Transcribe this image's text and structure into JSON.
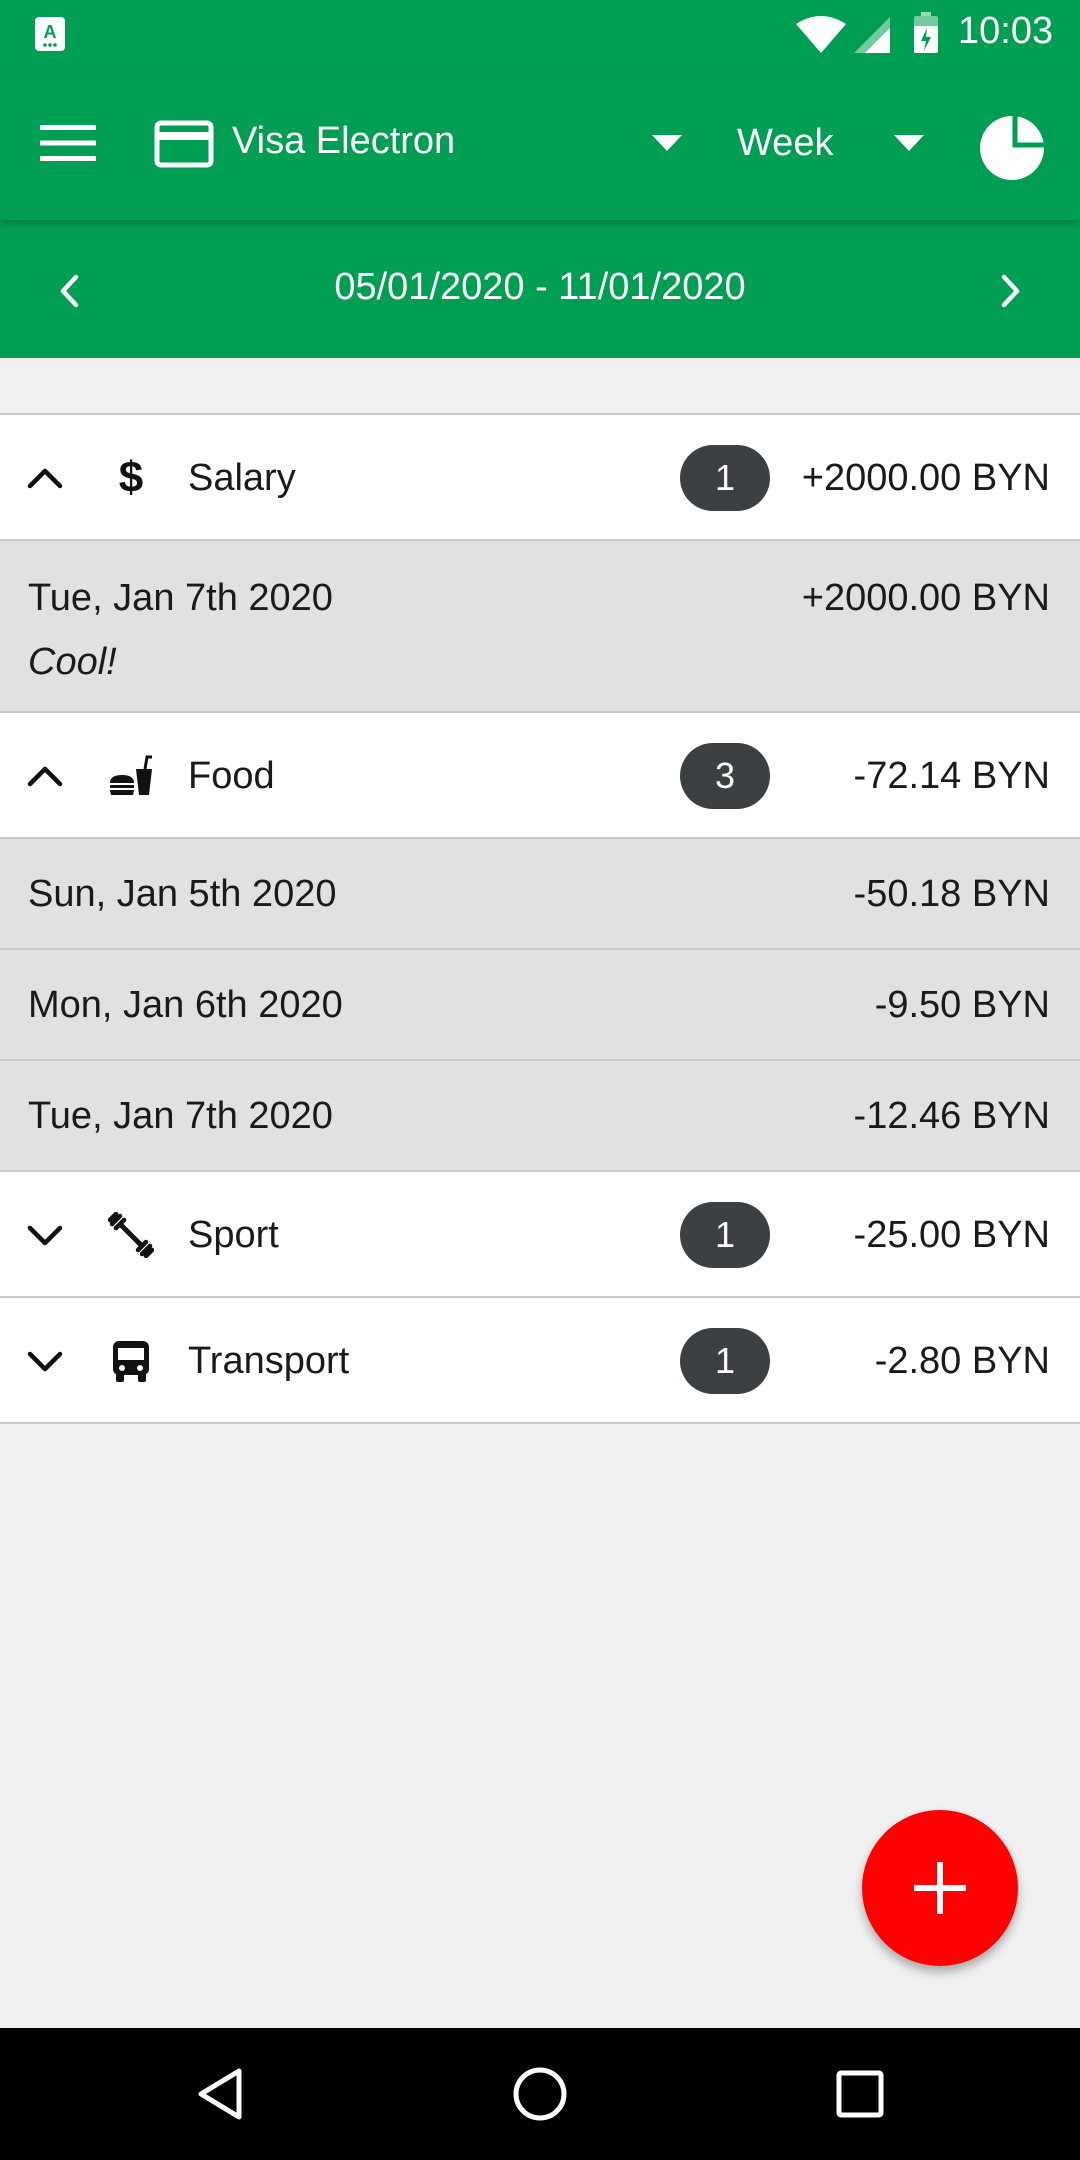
{
  "status_bar": {
    "time": "10:03",
    "icons": [
      "app-notification-icon",
      "wifi-icon",
      "signal-icon",
      "battery-charging-icon"
    ]
  },
  "toolbar": {
    "account_name": "Visa Electron",
    "period": "Week",
    "icons": [
      "menu-icon",
      "credit-card-icon",
      "dropdown-arrow-icon",
      "pie-chart-icon"
    ]
  },
  "range": {
    "label": "05/01/2020 - 11/01/2020"
  },
  "categories": [
    {
      "name": "Salary",
      "icon": "dollar-icon",
      "count": "1",
      "amount": "+2000.00 BYN",
      "expanded": true,
      "transactions": [
        {
          "date": "Tue, Jan 7th 2020",
          "amount": "+2000.00 BYN",
          "note": "Cool!"
        }
      ]
    },
    {
      "name": "Food",
      "icon": "fastfood-icon",
      "count": "3",
      "amount": "-72.14 BYN",
      "expanded": true,
      "transactions": [
        {
          "date": "Sun, Jan 5th 2020",
          "amount": "-50.18 BYN"
        },
        {
          "date": "Mon, Jan 6th 2020",
          "amount": "-9.50 BYN"
        },
        {
          "date": "Tue, Jan 7th 2020",
          "amount": "-12.46 BYN"
        }
      ]
    },
    {
      "name": "Sport",
      "icon": "fitness-icon",
      "count": "1",
      "amount": "-25.00 BYN",
      "expanded": false
    },
    {
      "name": "Transport",
      "icon": "bus-icon",
      "count": "1",
      "amount": "-2.80 BYN",
      "expanded": false
    }
  ],
  "colors": {
    "primary": "#009e52",
    "fab": "#ff0000",
    "badge": "#3c4043",
    "transaction_bg": "#e1e1e1",
    "list_bg": "#f1f1f1"
  }
}
